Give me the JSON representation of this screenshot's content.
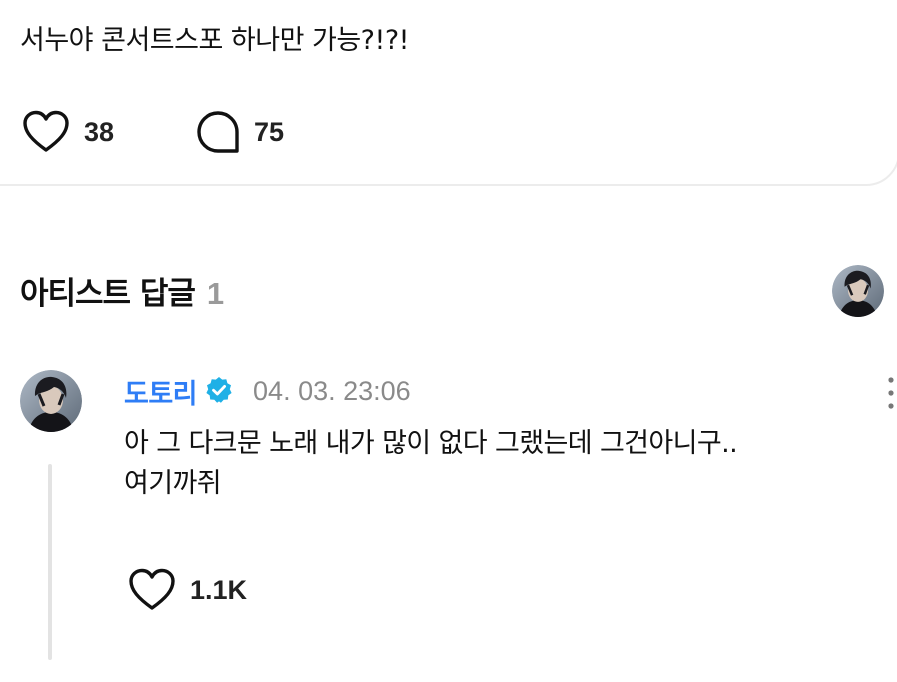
{
  "post": {
    "text": "서누야 콘서트스포 하나만 가능?!?!",
    "like_count": "38",
    "comment_count": "75",
    "icons": {
      "like": "heart-outline-icon",
      "comment": "speech-bubble-icon"
    }
  },
  "artist_replies": {
    "title": "아티스트 답글",
    "count": "1"
  },
  "comment": {
    "author": "도토리",
    "verified": true,
    "timestamp": "04. 03. 23:06",
    "text_lines": [
      "아 그 다크문 노래 내가 많이 없다 그랬는데 그건아니구..",
      "여기까쥐"
    ],
    "like_count": "1.1K"
  },
  "colors": {
    "author_name": "#2e7df6",
    "verified_badge": "#1fb0e6",
    "secondary_text": "#8a8a8a",
    "count_muted": "#9a9a9a"
  }
}
